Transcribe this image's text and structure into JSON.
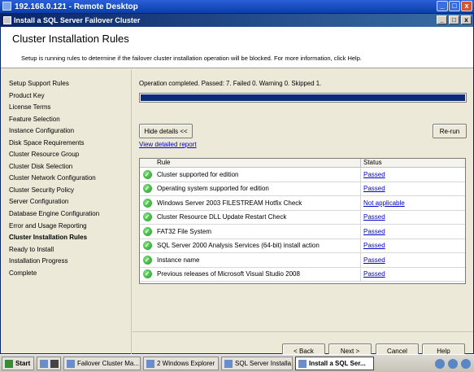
{
  "rdp": {
    "title": "192.168.0.121 - Remote Desktop",
    "min": "_",
    "max": "□",
    "close": "x"
  },
  "window": {
    "title": "Install a SQL Server Failover Cluster",
    "min": "_",
    "max": "□",
    "close": "x"
  },
  "header": {
    "title": "Cluster Installation Rules",
    "description": "Setup is running rules to determine if the failover cluster installation operation will be blocked. For more information, click Help."
  },
  "nav": [
    "Setup Support Rules",
    "Product Key",
    "License Terms",
    "Feature Selection",
    "Instance Configuration",
    "Disk Space Requirements",
    "Cluster Resource Group",
    "Cluster Disk Selection",
    "Cluster Network Configuration",
    "Cluster Security Policy",
    "Server Configuration",
    "Database Engine Configuration",
    "Error and Usage Reporting",
    "Cluster Installation Rules",
    "Ready to Install",
    "Installation Progress",
    "Complete"
  ],
  "nav_active": "Cluster Installation Rules",
  "status": {
    "text": "Operation completed.  Passed: 7.   Failed 0.   Warning 0.   Skipped 1.",
    "progress_fraction": 1.0
  },
  "buttons": {
    "hide_details": "Hide details <<",
    "rerun": "Re-run",
    "back": "< Back",
    "next": "Next >",
    "cancel": "Cancel",
    "help": "Help"
  },
  "view_report": "View detailed report",
  "grid": {
    "columns": [
      "Rule",
      "Status"
    ],
    "rows": [
      {
        "rule": "Cluster supported for edition",
        "status": "Passed"
      },
      {
        "rule": "Operating system supported for edition",
        "status": "Passed"
      },
      {
        "rule": "Windows Server 2003 FILESTREAM Hotfix Check",
        "status": "Not applicable"
      },
      {
        "rule": "Cluster Resource DLL Update Restart Check",
        "status": "Passed"
      },
      {
        "rule": "FAT32 File System",
        "status": "Passed"
      },
      {
        "rule": "SQL Server 2000 Analysis Services (64-bit) install action",
        "status": "Passed"
      },
      {
        "rule": "Instance name",
        "status": "Passed"
      },
      {
        "rule": "Previous releases of Microsoft Visual Studio 2008",
        "status": "Passed"
      }
    ]
  },
  "taskbar": {
    "start": "Start",
    "items": [
      "Failover Cluster Ma...",
      "2 Windows Explorer",
      "SQL Server Installa...",
      "Install a SQL Ser..."
    ],
    "active_index": 3
  },
  "colors": {
    "progress": "#0b2a7a",
    "link": "#0000cc",
    "passed_icon": "#1f9a1f"
  }
}
